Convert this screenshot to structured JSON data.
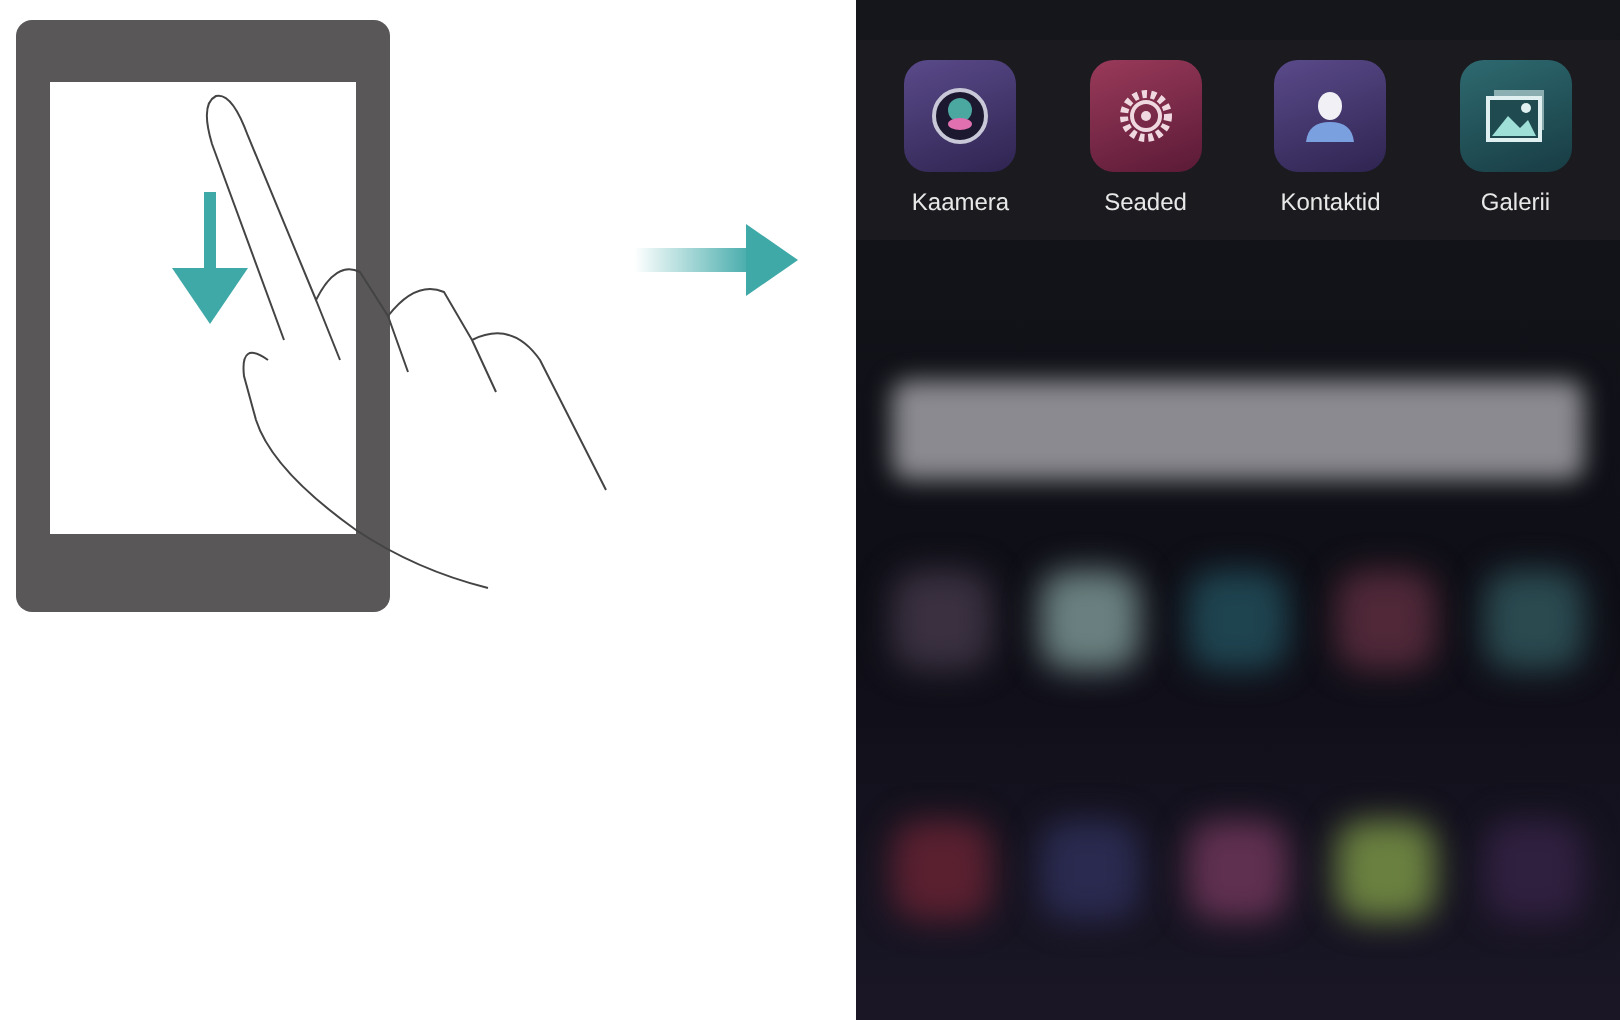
{
  "apps": [
    {
      "label": "Kaamera",
      "kind": "camera"
    },
    {
      "label": "Seaded",
      "kind": "settings"
    },
    {
      "label": "Kontaktid",
      "kind": "contacts"
    },
    {
      "label": "Galerii",
      "kind": "gallery"
    }
  ]
}
